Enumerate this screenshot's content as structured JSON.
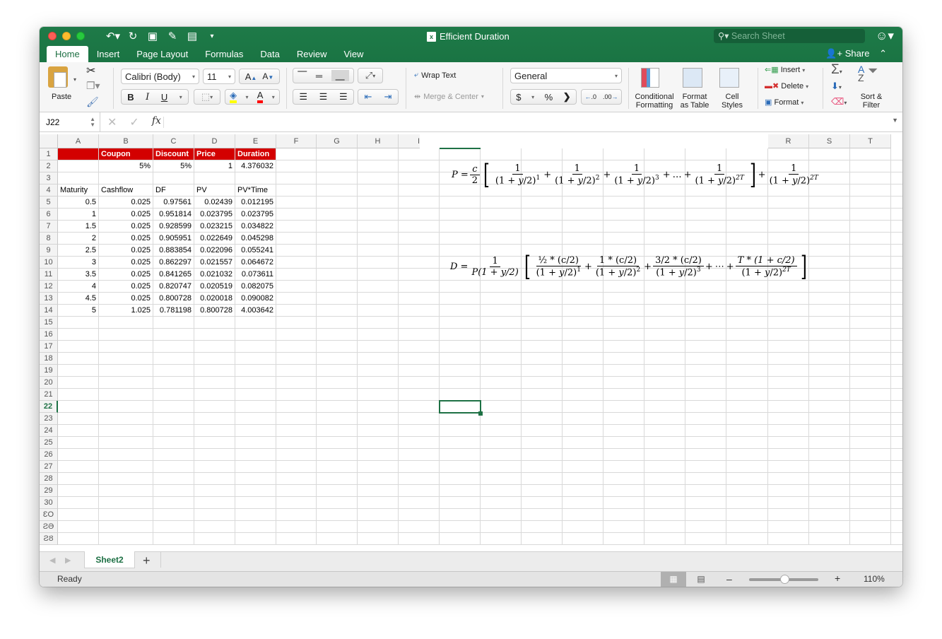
{
  "window": {
    "title": "Efficient Duration",
    "file_icon": "excel-file-icon"
  },
  "quick_access": [
    "undo-icon",
    "redo-icon",
    "save-icon",
    "edit-icon",
    "layout-icon",
    "customize-icon"
  ],
  "search": {
    "placeholder": "Search Sheet"
  },
  "ribbon_tabs": [
    {
      "label": "Home",
      "active": true
    },
    {
      "label": "Insert"
    },
    {
      "label": "Page Layout"
    },
    {
      "label": "Formulas"
    },
    {
      "label": "Data"
    },
    {
      "label": "Review"
    },
    {
      "label": "View"
    }
  ],
  "share_label": "Share",
  "ribbon": {
    "paste_label": "Paste",
    "font_name": "Calibri (Body)",
    "font_size": "11",
    "bold": "B",
    "italic": "I",
    "underline": "U",
    "wrap_text": "Wrap Text",
    "merge_center": "Merge & Center",
    "number_format": "General",
    "currency": "$",
    "percent": "%",
    "comma": "ʼ",
    "inc_decimal": ".0→.00",
    "dec_decimal": ".00→.0",
    "conditional_formatting": [
      "Conditional",
      "Formatting"
    ],
    "format_as_table": [
      "Format",
      "as Table"
    ],
    "cell_styles": [
      "Cell",
      "Styles"
    ],
    "insert": "Insert",
    "delete": "Delete",
    "format": "Format",
    "sort_filter": [
      "Sort &",
      "Filter"
    ],
    "accent_colors": {
      "highlight": "#ffff00",
      "font_color": "#ff0000"
    }
  },
  "formula_bar": {
    "name_box": "J22",
    "fx": "fx",
    "formula": ""
  },
  "columns": [
    "A",
    "B",
    "C",
    "D",
    "E",
    "F",
    "G",
    "H",
    "I",
    "R",
    "S",
    "T"
  ],
  "rows": [
    "1",
    "2",
    "3",
    "4",
    "5",
    "6",
    "7",
    "8",
    "9",
    "10",
    "11",
    "12",
    "13",
    "14",
    "15",
    "16",
    "17",
    "18",
    "19",
    "20",
    "21",
    "22",
    "23",
    "24",
    "25",
    "26",
    "27",
    "28",
    "29",
    "30",
    "ƐO",
    "ƧƏ",
    "ƧȢ"
  ],
  "active_row": "22",
  "sheet": {
    "header_row": {
      "B": "Coupon",
      "C": "Discount",
      "D": "Price",
      "E": "Duration"
    },
    "row2": {
      "B": "5%",
      "C": "5%",
      "D": "1",
      "E": "4.376032"
    },
    "table_headers": [
      "Maturity",
      "Cashflow",
      "DF",
      "PV",
      "PV*Time"
    ],
    "table_rows": [
      [
        "0.5",
        "0.025",
        "0.97561",
        "0.02439",
        "0.012195"
      ],
      [
        "1",
        "0.025",
        "0.951814",
        "0.023795",
        "0.023795"
      ],
      [
        "1.5",
        "0.025",
        "0.928599",
        "0.023215",
        "0.034822"
      ],
      [
        "2",
        "0.025",
        "0.905951",
        "0.022649",
        "0.045298"
      ],
      [
        "2.5",
        "0.025",
        "0.883854",
        "0.022096",
        "0.055241"
      ],
      [
        "3",
        "0.025",
        "0.862297",
        "0.021557",
        "0.064672"
      ],
      [
        "3.5",
        "0.025",
        "0.841265",
        "0.021032",
        "0.073611"
      ],
      [
        "4",
        "0.025",
        "0.820747",
        "0.020519",
        "0.082075"
      ],
      [
        "4.5",
        "0.025",
        "0.800728",
        "0.020018",
        "0.090082"
      ],
      [
        "5",
        "1.025",
        "0.781198",
        "0.800728",
        "4.003642"
      ]
    ],
    "header_color": "#d30000"
  },
  "equations": {
    "price": {
      "lhs": "P =",
      "coef_num": "c",
      "coef_den": "2",
      "terms": [
        {
          "num": "1",
          "exp": "1"
        },
        {
          "num": "1",
          "exp": "2"
        },
        {
          "num": "1",
          "exp": "3"
        },
        {
          "num": "1",
          "exp": "2T"
        }
      ],
      "ellipsis": "…",
      "tail": {
        "num": "1",
        "exp": "2T"
      }
    },
    "duration": {
      "lhs": "D =",
      "pre_num": "1",
      "pre_den": "P(1 + y/2)",
      "terms": [
        {
          "num": "½ * (c/2)",
          "exp": "1"
        },
        {
          "num": "1 * (c/2)",
          "exp": "2"
        },
        {
          "num": "3/2 * (c/2)",
          "exp": "3"
        },
        {
          "num": "T * (1 + c/2)",
          "exp": "2T"
        }
      ],
      "ellipsis": "⋯"
    }
  },
  "sheet_tabs": [
    {
      "label": "Sheet2",
      "active": true
    }
  ],
  "add_sheet": "+",
  "status": {
    "text": "Ready",
    "zoom": "110%",
    "zoom_level_percent": 110
  }
}
